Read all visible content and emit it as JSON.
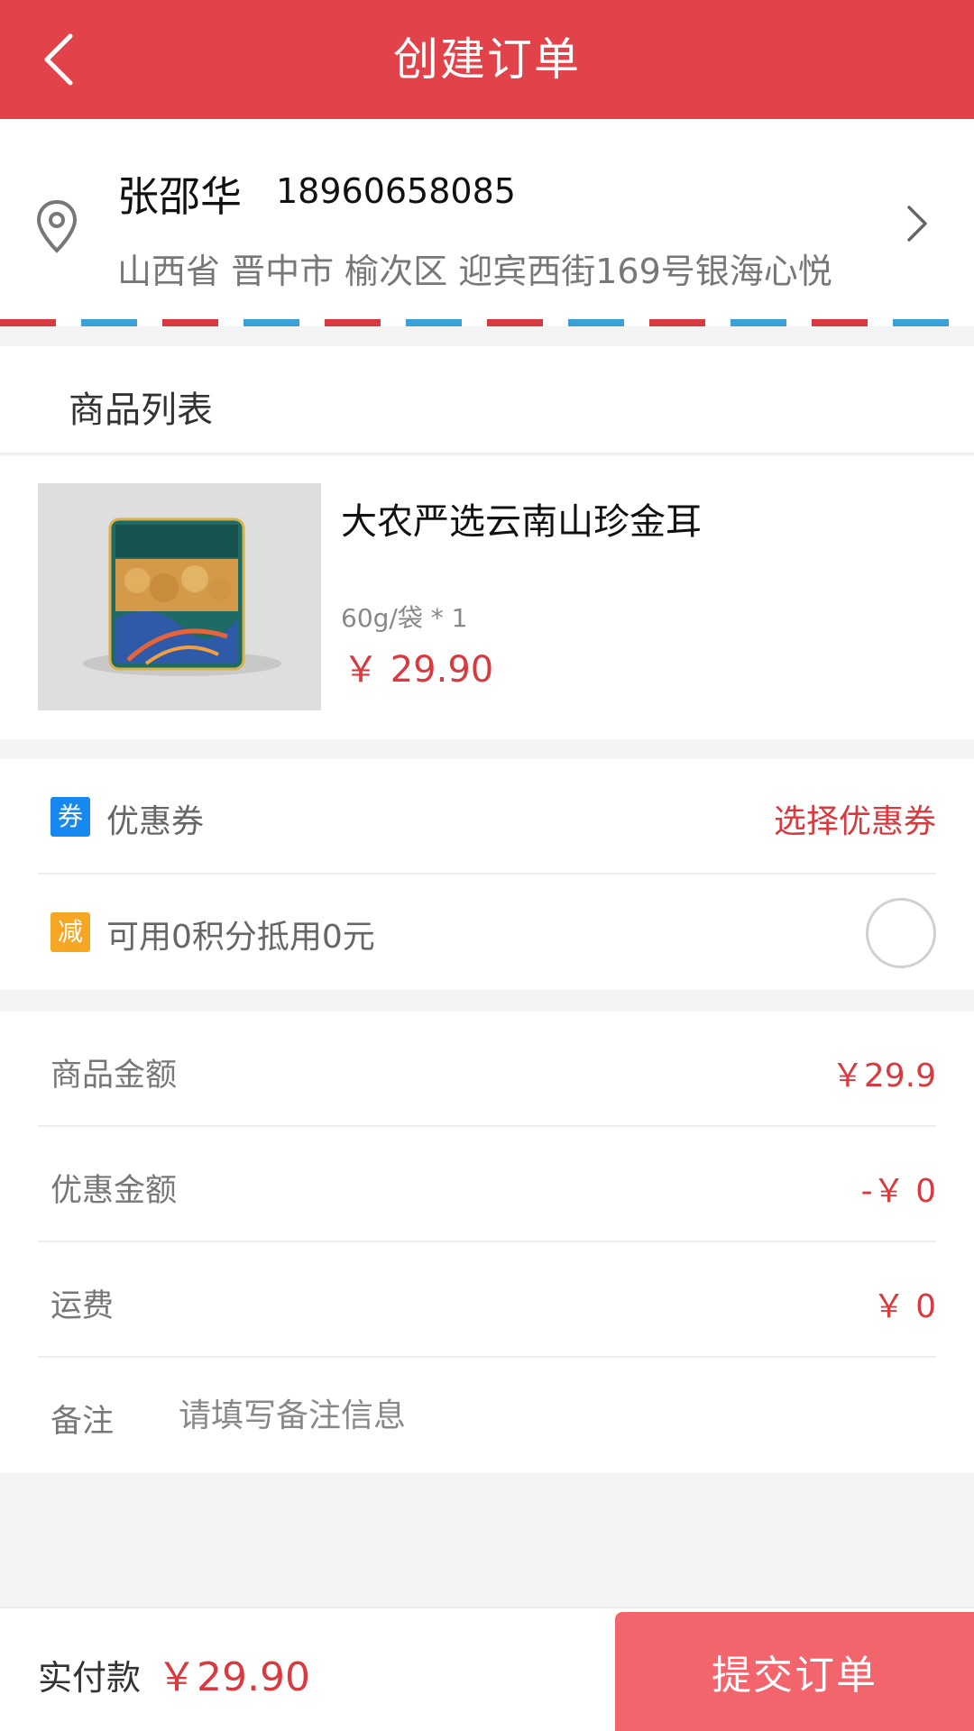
{
  "header": {
    "title": "创建订单"
  },
  "address": {
    "name": "张邵华",
    "phone": "18960658085",
    "detail": "山西省 晋中市 榆次区 迎宾西街169号银海心悦"
  },
  "goods": {
    "section_title": "商品列表",
    "item": {
      "name": "大农严选云南山珍金耳",
      "spec": "60g/袋 * 1",
      "price": "￥ 29.90"
    }
  },
  "coupon": {
    "tag": "券",
    "label": "优惠券",
    "action": "选择优惠券"
  },
  "points": {
    "tag": "减",
    "label": "可用0积分抵用0元",
    "checked": false
  },
  "summary": {
    "goods_amount_label": "商品金额",
    "goods_amount_value": "￥29.9",
    "discount_label": "优惠金额",
    "discount_value": "-￥ 0",
    "shipping_label": "运费",
    "shipping_value": "￥ 0",
    "remark_label": "备注",
    "remark_placeholder": "请填写备注信息"
  },
  "footer": {
    "pay_label": "实付款",
    "pay_amount": "￥29.90",
    "submit_label": "提交订单"
  },
  "colors": {
    "header_bg": "#e2434a",
    "accent_red": "#d83a3f",
    "submit_bg": "#f3656c",
    "coupon_tag": "#1688f0",
    "points_tag": "#f5a623"
  }
}
